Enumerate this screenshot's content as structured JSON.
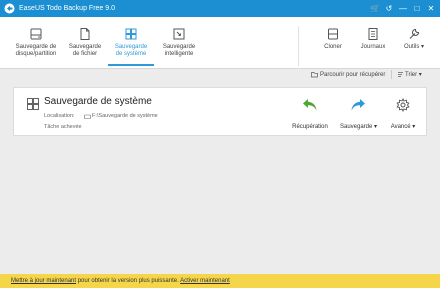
{
  "app": {
    "title": "EaseUS Todo Backup Free 9.0",
    "window_controls": [
      "🛒",
      "↺",
      "—",
      "□",
      "✕"
    ]
  },
  "toolbar": {
    "items": [
      {
        "label_line1": "Sauvegarde de",
        "label_line2": "disque/partition",
        "icon": "disk-icon"
      },
      {
        "label_line1": "Sauvegarde",
        "label_line2": "de fichier",
        "icon": "file-icon"
      },
      {
        "label_line1": "Sauvegarde",
        "label_line2": "de système",
        "icon": "windows-icon",
        "active": true
      },
      {
        "label_line1": "Sauvegarde",
        "label_line2": "intelligente",
        "icon": "smart-backup-icon"
      }
    ],
    "right_items": [
      {
        "label": "Cloner",
        "icon": "clone-icon"
      },
      {
        "label": "Journaux",
        "icon": "logs-icon"
      },
      {
        "label": "Outils",
        "icon": "tools-icon"
      }
    ]
  },
  "sortbar": {
    "browse_label": "Parcourir pour récupérer",
    "sort_label": "Trier"
  },
  "task": {
    "title": "Sauvegarde de système",
    "location_label": "Localisation:",
    "location_value": "F:\\Sauvegarde de système",
    "status": "Tâche achevée",
    "actions": {
      "recovery": "Récupération",
      "backup": "Sauvegarde",
      "advanced": "Avancé"
    }
  },
  "notice": {
    "upgrade_link": "Mettre à jour maintenant",
    "middle_text": " pour obtenir la version plus puissante. ",
    "activate_link": "Activer maintenant"
  },
  "colors": {
    "titlebar": "#1b8fd1",
    "accent": "#2e9ad8",
    "recovery_green": "#4ca832",
    "notice_bar": "#f5d64a"
  }
}
